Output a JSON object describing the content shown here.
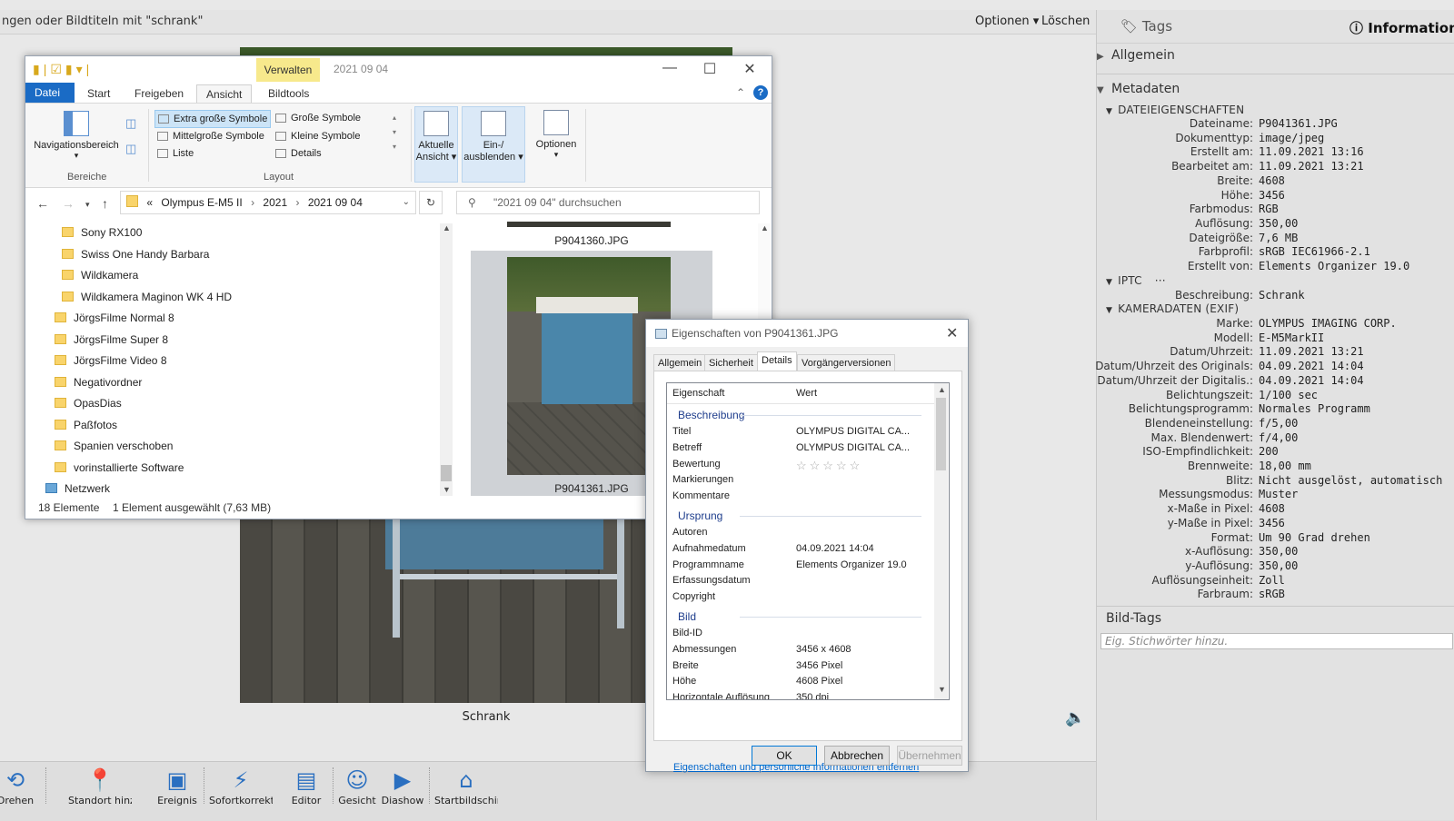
{
  "organizer": {
    "search_text": "ngen oder Bildtiteln mit \"schrank\"",
    "options_label": "Optionen ▾",
    "delete_label": "Löschen",
    "caption": "Schrank",
    "toolbar": [
      {
        "icon": "rotate-icon",
        "label": "Drehen"
      },
      {
        "icon": "add-location-icon",
        "label": "Standort hinzufügen"
      },
      {
        "icon": "event-icon",
        "label": "Ereignis"
      },
      {
        "icon": "instant-fix-icon",
        "label": "Sofortkorrektur"
      },
      {
        "icon": "editor-icon",
        "label": "Editor"
      },
      {
        "icon": "people-icon",
        "label": "Gesicht"
      },
      {
        "icon": "slideshow-icon",
        "label": "Diashow"
      },
      {
        "icon": "home-icon",
        "label": "Startbildschirm"
      }
    ],
    "zoom_slider_level": 1.0
  },
  "right_panel": {
    "tab_tags": "Tags",
    "tab_info": "Informationen",
    "section_general": "Allgemein",
    "section_metadata": "Metadaten",
    "file_props_title": "DATEIEIGENSCHAFTEN",
    "file_props": [
      {
        "k": "Dateiname:",
        "v": "P9041361.JPG"
      },
      {
        "k": "Dokumenttyp:",
        "v": "image/jpeg"
      },
      {
        "k": "Erstellt am:",
        "v": "11.09.2021 13:16"
      },
      {
        "k": "Bearbeitet am:",
        "v": "11.09.2021 13:21"
      },
      {
        "k": "Breite:",
        "v": "4608"
      },
      {
        "k": "Höhe:",
        "v": "3456"
      },
      {
        "k": "Farbmodus:",
        "v": "RGB"
      },
      {
        "k": "Auflösung:",
        "v": "350,00"
      },
      {
        "k": "Dateigröße:",
        "v": "7,6 MB"
      },
      {
        "k": "Farbprofil:",
        "v": "sRGB IEC61966-2.1"
      },
      {
        "k": "Erstellt von:",
        "v": "Elements Organizer 19.0"
      }
    ],
    "iptc_title": "IPTC",
    "iptc_more": "···",
    "iptc": [
      {
        "k": "Beschreibung:",
        "v": "Schrank"
      }
    ],
    "exif_title": "KAMERADATEN (EXIF)",
    "exif": [
      {
        "k": "Marke:",
        "v": "OLYMPUS IMAGING CORP."
      },
      {
        "k": "Modell:",
        "v": "E-M5MarkII"
      },
      {
        "k": "Datum/Uhrzeit:",
        "v": "11.09.2021 13:21"
      },
      {
        "k": "Datum/Uhrzeit des Originals:",
        "v": "04.09.2021 14:04"
      },
      {
        "k": "Datum/Uhrzeit der Digitalis.:",
        "v": "04.09.2021 14:04"
      },
      {
        "k": "Belichtungszeit:",
        "v": "1/100 sec"
      },
      {
        "k": "Belichtungsprogramm:",
        "v": "Normales Programm"
      },
      {
        "k": "Blendeneinstellung:",
        "v": "f/5,00"
      },
      {
        "k": "Max. Blendenwert:",
        "v": "f/4,00"
      },
      {
        "k": "ISO-Empfindlichkeit:",
        "v": "200"
      },
      {
        "k": "Brennweite:",
        "v": "18,00 mm"
      },
      {
        "k": "Blitz:",
        "v": "Nicht ausgelöst, automatisch"
      },
      {
        "k": "Messungsmodus:",
        "v": "Muster"
      },
      {
        "k": "x-Maße in Pixel:",
        "v": "4608"
      },
      {
        "k": "y-Maße in Pixel:",
        "v": "3456"
      },
      {
        "k": "Format:",
        "v": "Um 90 Grad drehen"
      },
      {
        "k": "x-Auflösung:",
        "v": "350,00"
      },
      {
        "k": "y-Auflösung:",
        "v": "350,00"
      },
      {
        "k": "Auflösungseinheit:",
        "v": "Zoll"
      },
      {
        "k": "Farbraum:",
        "v": "sRGB"
      }
    ],
    "bild_tags_title": "Bild-Tags",
    "tag_input_placeholder": "Eig. Stichwörter hinzu."
  },
  "explorer": {
    "manage_tab": "Verwalten",
    "window_title": "2021 09 04",
    "tabs": [
      "Datei",
      "Start",
      "Freigeben",
      "Ansicht",
      "Bildtools"
    ],
    "ribbon": {
      "nav_pane": "Navigationsbereich",
      "group_areas": "Bereiche",
      "layout_items": [
        "Extra große Symbole",
        "Große Symbole",
        "Mittelgroße Symbole",
        "Kleine Symbole",
        "Liste",
        "Details"
      ],
      "group_layout": "Layout",
      "current_view": "Aktuelle Ansicht ▾",
      "show_hide": "Ein-/ ausblenden ▾",
      "options": "Optionen"
    },
    "address": {
      "prefix": "«",
      "crumbs": [
        "Olympus E-M5 II",
        "2021",
        "2021 09 04"
      ]
    },
    "search_placeholder": "\"2021 09 04\" durchsuchen",
    "tree": [
      "Sony RX100",
      "Swiss One Handy Barbara",
      "Wildkamera",
      "Wildkamera Maginon WK 4 HD",
      "JörgsFilme Normal 8",
      "JörgsFilme Super 8",
      "JörgsFilme Video 8",
      "Negativordner",
      "OpasDias",
      "Paßfotos",
      "Spanien verschoben",
      "vorinstallierte Software",
      "Netzwerk"
    ],
    "files": [
      "P9041360.JPG",
      "P9041361.JPG"
    ],
    "status": {
      "count": "18 Elemente",
      "selected": "1 Element ausgewählt (7,63 MB)"
    }
  },
  "properties": {
    "title": "Eigenschaften von P9041361.JPG",
    "tabs": [
      "Allgemein",
      "Sicherheit",
      "Details",
      "Vorgängerversionen"
    ],
    "col_property": "Eigenschaft",
    "col_value": "Wert",
    "sections": {
      "description": "Beschreibung",
      "origin": "Ursprung",
      "image": "Bild"
    },
    "desc_rows": [
      {
        "k": "Titel",
        "v": "OLYMPUS DIGITAL CA..."
      },
      {
        "k": "Betreff",
        "v": "OLYMPUS DIGITAL CA..."
      },
      {
        "k": "Bewertung",
        "v": "☆☆☆☆☆"
      },
      {
        "k": "Markierungen",
        "v": ""
      },
      {
        "k": "Kommentare",
        "v": ""
      }
    ],
    "origin_rows": [
      {
        "k": "Autoren",
        "v": ""
      },
      {
        "k": "Aufnahmedatum",
        "v": "04.09.2021 14:04"
      },
      {
        "k": "Programmname",
        "v": "Elements Organizer 19.0"
      },
      {
        "k": "Erfassungsdatum",
        "v": ""
      },
      {
        "k": "Copyright",
        "v": ""
      }
    ],
    "image_rows": [
      {
        "k": "Bild-ID",
        "v": ""
      },
      {
        "k": "Abmessungen",
        "v": "3456 x 4608"
      },
      {
        "k": "Breite",
        "v": "3456 Pixel"
      },
      {
        "k": "Höhe",
        "v": "4608 Pixel"
      },
      {
        "k": "Horizontale Auflösung",
        "v": "350 dpi"
      }
    ],
    "remove_link": "Eigenschaften und persönliche Informationen entfernen",
    "ok": "OK",
    "cancel": "Abbrechen",
    "apply": "Übernehmen"
  }
}
